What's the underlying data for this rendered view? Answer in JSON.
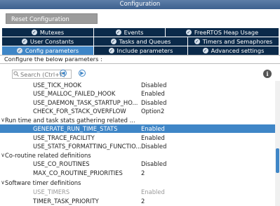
{
  "window": {
    "title": "Configuration"
  },
  "toolbar": {
    "reset_label": "Reset Configuration"
  },
  "tabs": {
    "row1": [
      "Mutexes",
      "Events",
      "FreeRTOS Heap Usage"
    ],
    "row2": [
      "User Constants",
      "Tasks and Queues",
      "Timers and Semaphores"
    ],
    "row3": [
      "Config parameters",
      "Include parameters",
      "Advanced settings"
    ],
    "active": "Config parameters"
  },
  "info": {
    "text": "Configure the below parameters :"
  },
  "search": {
    "placeholder": "Search (Ctrl+F)"
  },
  "tree": {
    "rows": [
      {
        "type": "param",
        "name": "USE_TICK_HOOK",
        "value": "Disabled"
      },
      {
        "type": "param",
        "name": "USE_MALLOC_FAILED_HOOK",
        "value": "Enabled"
      },
      {
        "type": "param",
        "name": "USE_DAEMON_TASK_STARTUP_HO...",
        "value": "Disabled"
      },
      {
        "type": "param",
        "name": "CHECK_FOR_STACK_OVERFLOW",
        "value": "Option2"
      },
      {
        "type": "group",
        "name": "Run time and task stats gathering related ..."
      },
      {
        "type": "param",
        "name": "GENERATE_RUN_TIME_STATS",
        "value": "Enabled",
        "selected": true
      },
      {
        "type": "param",
        "name": "USE_TRACE_FACILITY",
        "value": "Enabled"
      },
      {
        "type": "param",
        "name": "USE_STATS_FORMATTING_FUNCTIO...",
        "value": "Disabled"
      },
      {
        "type": "group",
        "name": "Co-routine related definitions"
      },
      {
        "type": "param",
        "name": "USE_CO_ROUTINES",
        "value": "Disabled"
      },
      {
        "type": "param",
        "name": "MAX_CO_ROUTINE_PRIORITIES",
        "value": "2"
      },
      {
        "type": "group",
        "name": "Software timer definitions"
      },
      {
        "type": "param",
        "name": "USE_TIMERS",
        "value": "Enabled",
        "muted": true
      },
      {
        "type": "param",
        "name": "TIMER_TASK_PRIORITY",
        "value": "2"
      }
    ]
  },
  "colors": {
    "tab_bg": "#0b2a4a",
    "tab_active": "#3f86c7",
    "selected_row": "#3f86c7",
    "title_bar": "#4a6d9a"
  }
}
